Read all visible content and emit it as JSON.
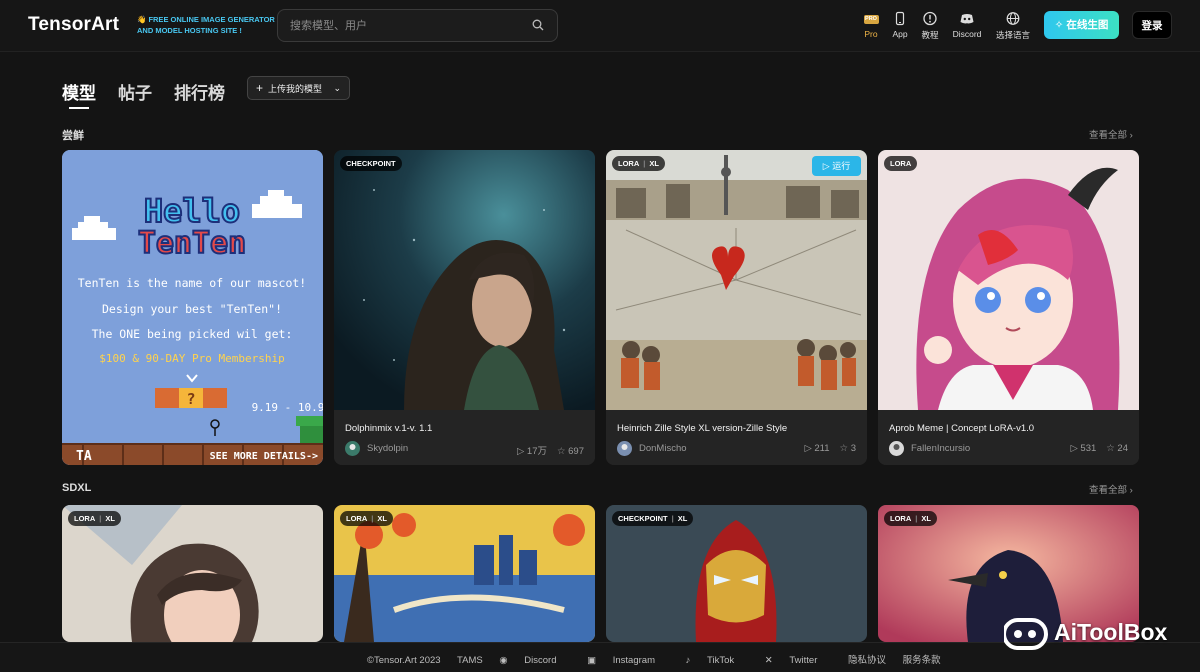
{
  "brand": {
    "logo": "TensorArt",
    "slogan_line1": "FREE ONLINE IMAGE GENERATOR",
    "slogan_line2": "AND MODEL HOSTING SITE !",
    "slogan_emoji": "👋",
    "accent": "#3bd2e6"
  },
  "search": {
    "placeholder": "搜索模型、用户",
    "icon": "search-icon"
  },
  "nav": [
    {
      "label": "Pro",
      "icon": "pro-badge-icon",
      "badge": "PRO"
    },
    {
      "label": "App",
      "icon": "phone-icon"
    },
    {
      "label": "教程",
      "icon": "info-icon"
    },
    {
      "label": "Discord",
      "icon": "discord-icon"
    },
    {
      "label": "选择语言",
      "icon": "globe-icon"
    }
  ],
  "header_actions": {
    "cta": "在线生图",
    "cta_icon": "magic-wand-icon",
    "login": "登录"
  },
  "tabs": [
    {
      "label": "模型",
      "active": true
    },
    {
      "label": "帖子",
      "active": false
    },
    {
      "label": "排行榜",
      "active": false
    }
  ],
  "upload": {
    "label": "上传我的模型",
    "icon": "plus-icon"
  },
  "sections": [
    {
      "title": "尝鲜",
      "view_all": "查看全部",
      "cards": [
        {
          "type": "banner",
          "banner_title_1": "Hello",
          "banner_title_2": "TenTen",
          "line1": "TenTen is the name of our mascot!",
          "line2": "Design your best \"TenTen\"!",
          "line3": "The ONE being picked wil get:",
          "prize": "$100 & 90-DAY Pro Membership",
          "date": "9.19 - 10.9",
          "footer_logo": "TA",
          "footer_cta": "SEE MORE DETAILS->"
        },
        {
          "tags": [
            "CHECKPOINT"
          ],
          "title": "Dolphinmix v.1-v. 1.1",
          "author": "Skydolpin",
          "runs": "17万",
          "stars": "697"
        },
        {
          "tags": [
            "LORA",
            "XL"
          ],
          "run_label": "运行",
          "title": "Heinrich Zille Style XL version-Zille Style",
          "author": "DonMischo",
          "runs": "211",
          "stars": "3"
        },
        {
          "tags": [
            "LORA"
          ],
          "title": "Aprob Meme | Concept LoRA-v1.0",
          "author": "FallenIncursio",
          "runs": "531",
          "stars": "24"
        }
      ]
    },
    {
      "title": "SDXL",
      "view_all": "查看全部",
      "cards": [
        {
          "tags": [
            "LORA",
            "XL"
          ]
        },
        {
          "tags": [
            "LORA",
            "XL"
          ]
        },
        {
          "tags": [
            "CHECKPOINT",
            "XL"
          ]
        },
        {
          "tags": [
            "LORA",
            "XL"
          ]
        }
      ]
    }
  ],
  "footer": {
    "copyright": "©Tensor.Art 2023",
    "links": [
      "TAMS",
      "Discord",
      "Instagram",
      "TikTok",
      "Twitter",
      "隐私协议",
      "服务条款"
    ]
  },
  "watermark": "AiToolBox"
}
